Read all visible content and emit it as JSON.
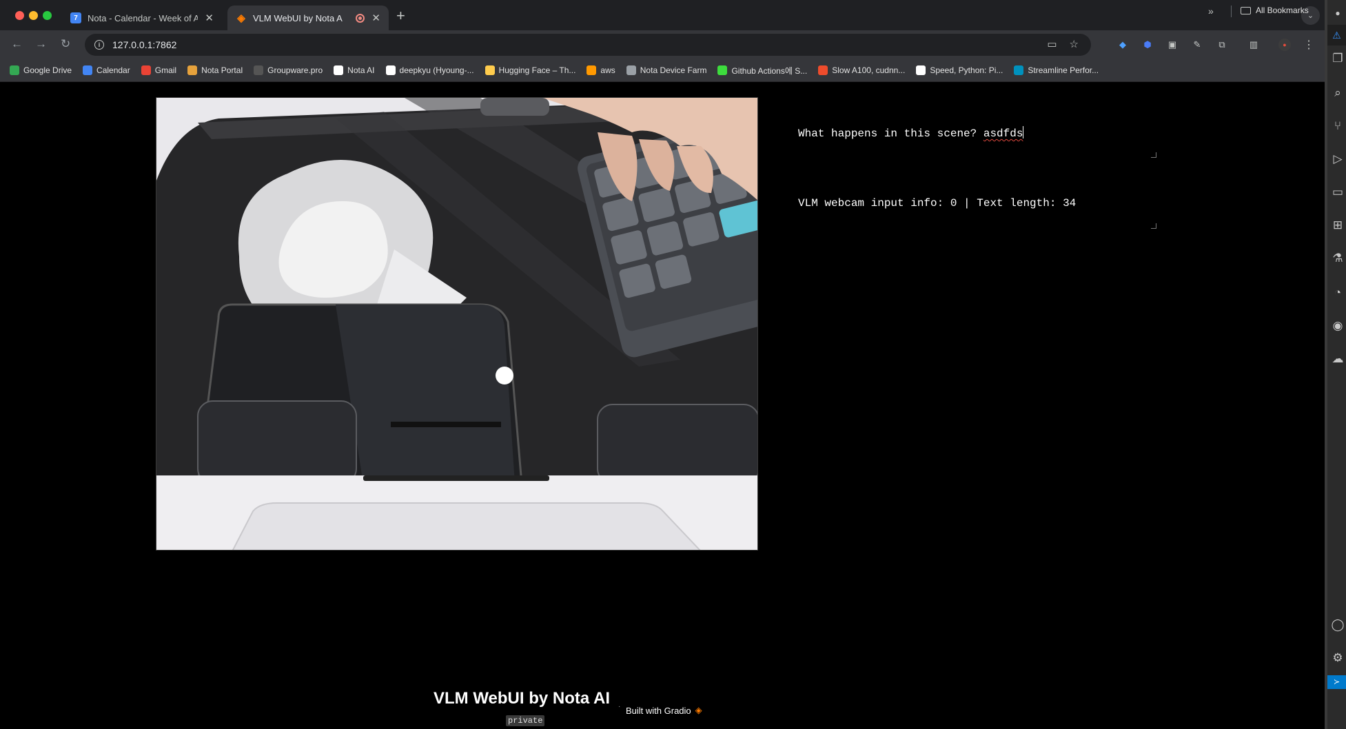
{
  "browser": {
    "tabs": [
      {
        "title": "Nota - Calendar - Week of Ap",
        "favicon": "calendar-icon",
        "active": false
      },
      {
        "title": "VLM WebUI by Nota AI",
        "favicon": "gradio-logo-icon",
        "active": true
      }
    ],
    "new_tab_label": "+",
    "close_label": "✕",
    "url": "127.0.0.1:7862",
    "bookmarks": [
      {
        "label": "Google Drive",
        "icon": "google-drive-icon",
        "color": "#34a853"
      },
      {
        "label": "Calendar",
        "icon": "calendar-icon",
        "color": "#4285f4"
      },
      {
        "label": "Gmail",
        "icon": "gmail-icon",
        "color": "#ea4335"
      },
      {
        "label": "Nota Portal",
        "icon": "house-icon",
        "color": "#e6a23c"
      },
      {
        "label": "Groupware.pro",
        "icon": "groupware-icon",
        "color": "#555555"
      },
      {
        "label": "Nota AI",
        "icon": "github-icon",
        "color": "#ffffff"
      },
      {
        "label": "deepkyu (Hyoung-...",
        "icon": "github-icon",
        "color": "#ffffff"
      },
      {
        "label": "Hugging Face – Th...",
        "icon": "hugging-face-icon",
        "color": "#ffcc4d"
      },
      {
        "label": "aws",
        "icon": "aws-icon",
        "color": "#ff9900"
      },
      {
        "label": "Nota Device Farm",
        "icon": "globe-icon",
        "color": "#9aa0a6"
      },
      {
        "label": "Github Actions에 S...",
        "icon": "d-icon",
        "color": "#3ddc3d"
      },
      {
        "label": "Slow A100, cudnn...",
        "icon": "pytorch-icon",
        "color": "#ee4c2c"
      },
      {
        "label": "Speed, Python: Pi...",
        "icon": "medium-icon",
        "color": "#ffffff"
      },
      {
        "label": "Streamline Perfor...",
        "icon": "arm-icon",
        "color": "#0091bd"
      }
    ],
    "bookmarks_overflow": "»",
    "all_bookmarks": "All Bookmarks"
  },
  "app": {
    "prompt_text": "What happens in this scene? ",
    "prompt_typo": "asdfds",
    "info_text": "VLM webcam input info: 0 | Text length: 34",
    "footer_title": "VLM WebUI by Nota AI",
    "footer_separator": "·",
    "footer_built": "Built with Gradio",
    "footer_private": "private"
  }
}
